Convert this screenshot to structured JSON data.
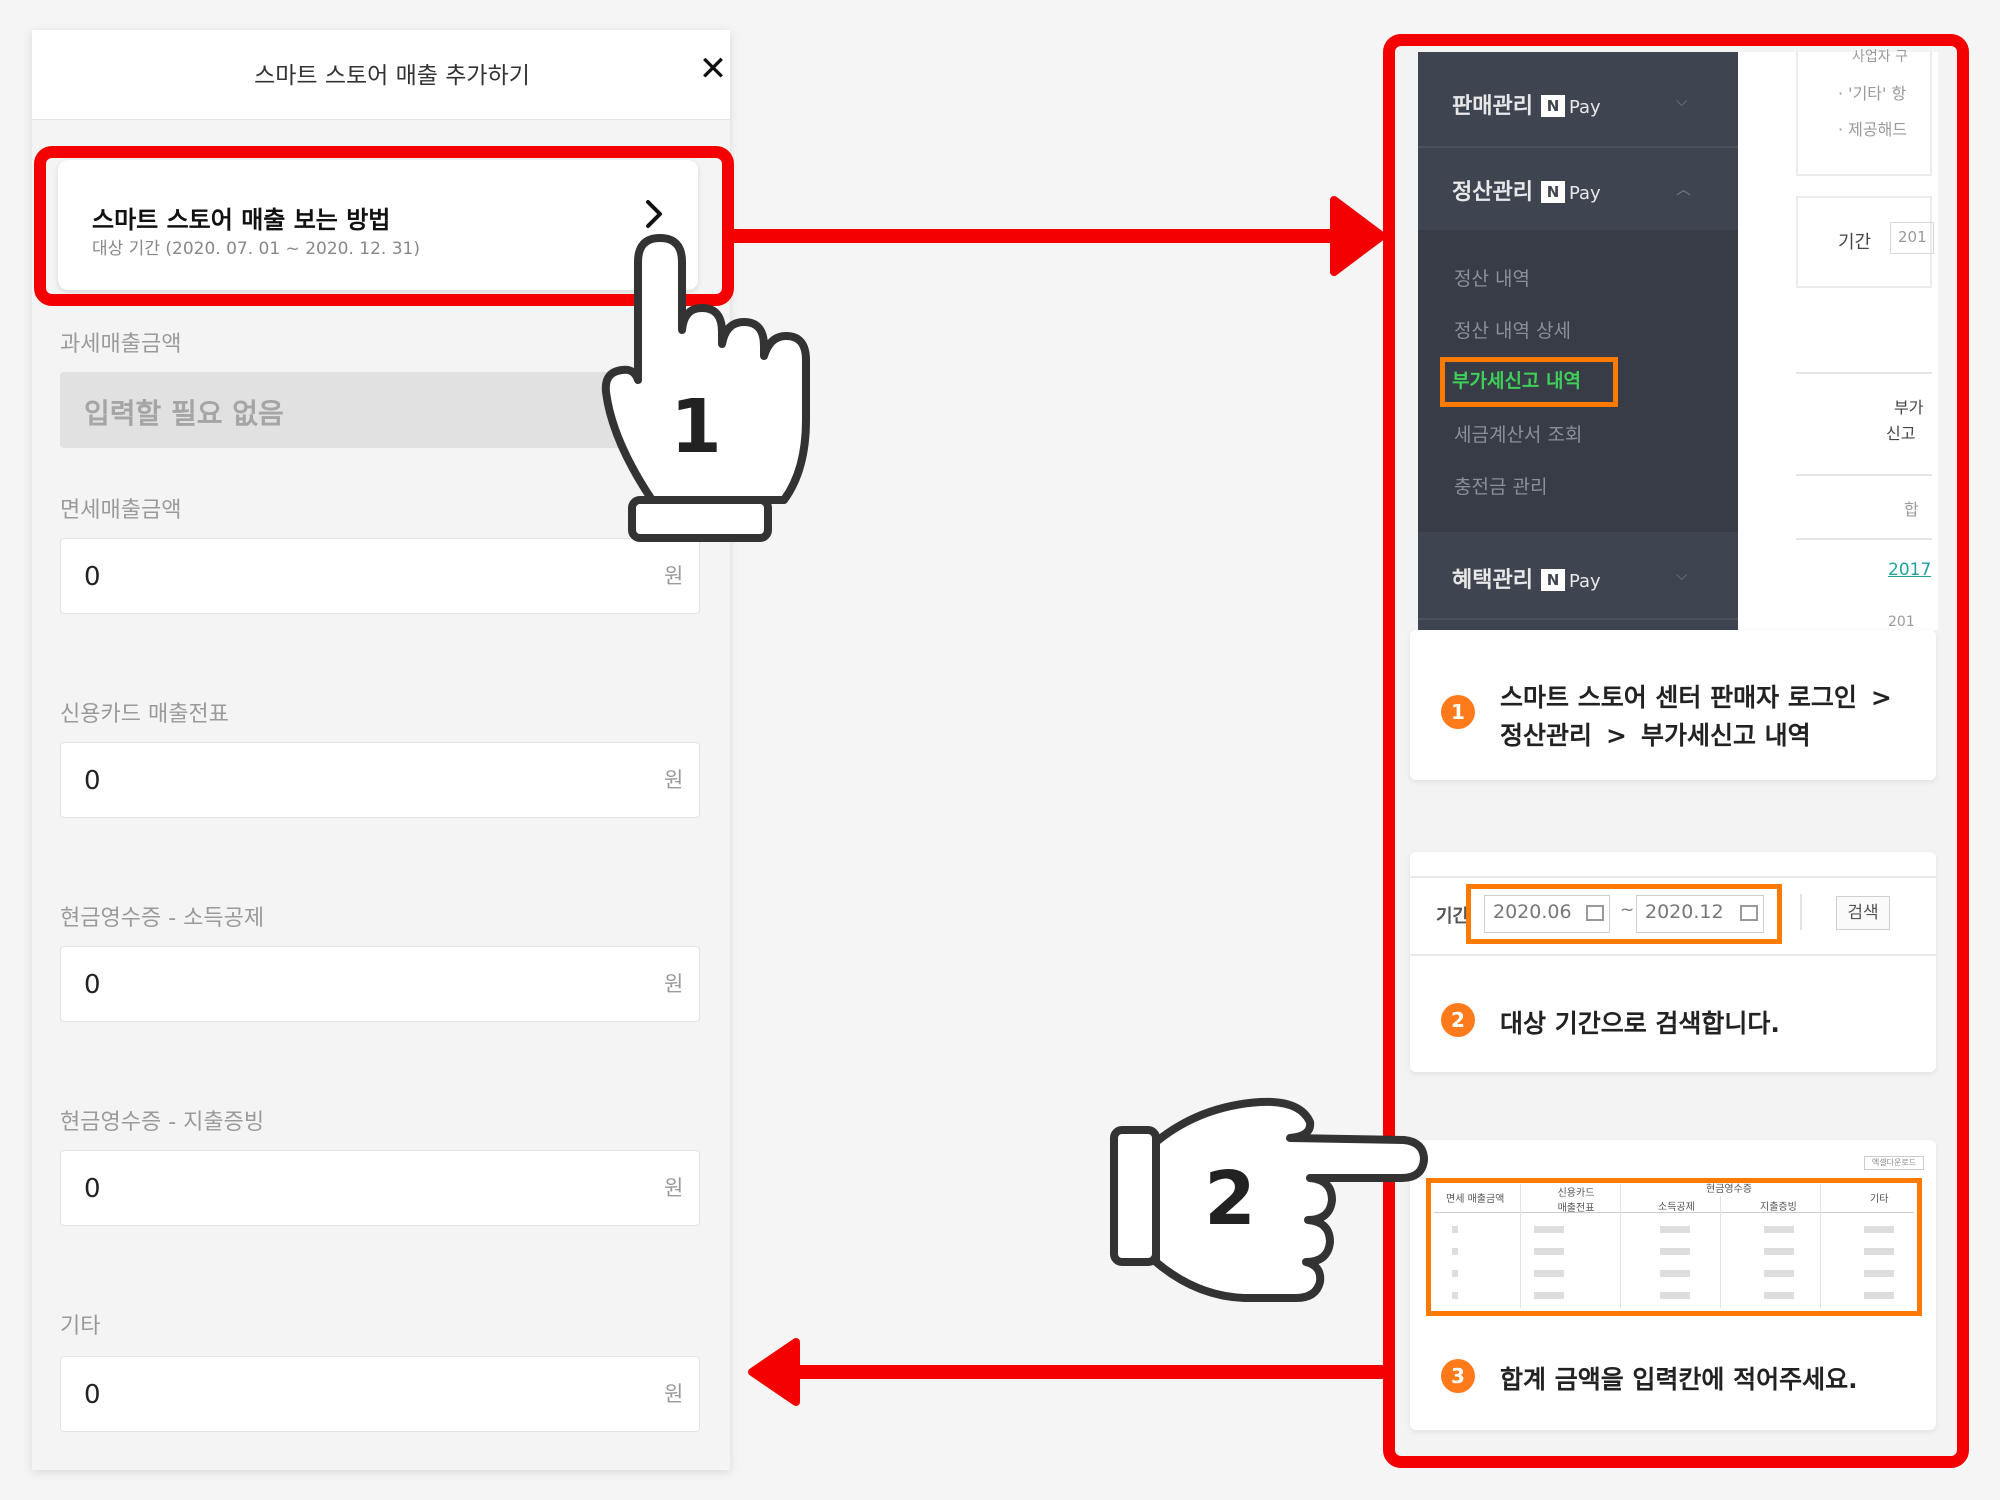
{
  "form": {
    "title": "스마트 스토어 매출 추가하기",
    "howto": {
      "title": "스마트 스토어 매출 보는 방법",
      "period": "대상 기간 (2020. 07. 01 ~ 2020. 12. 31)"
    },
    "taxed_label": "과세매출금액",
    "taxed_placeholder": "입력할 필요 없음",
    "fields": [
      {
        "label": "면세매출금액",
        "value": "0",
        "unit": "원"
      },
      {
        "label": "신용카드 매출전표",
        "value": "0",
        "unit": "원"
      },
      {
        "label": "현금영수증 - 소득공제",
        "value": "0",
        "unit": "원"
      },
      {
        "label": "현금영수증 - 지출증빙",
        "value": "0",
        "unit": "원"
      },
      {
        "label": "기타",
        "value": "0",
        "unit": "원"
      }
    ]
  },
  "hands": {
    "one": "1",
    "two": "2"
  },
  "guide": {
    "nav": {
      "sales": "판매관리",
      "settlement": "정산관리",
      "benefit": "혜택관리",
      "pay_badge": "N",
      "pay_text": "Pay",
      "sub_items": [
        "정산 내역",
        "정산 내역 상세",
        "부가세신고 내역",
        "세금계산서 조회",
        "충전금 관리"
      ]
    },
    "sliver": {
      "top": "사업자 구",
      "etc": "· '기타' 항",
      "provider": "· 제공해드",
      "period": "기간",
      "year": "201",
      "col1": "부가",
      "col2": "신고",
      "sum": "합",
      "link": "2017",
      "tail": "201"
    },
    "step1": {
      "num": "1",
      "line1": "스마트 스토어 센터 판매자 로그인",
      "line2_a": "정산관리",
      "line2_b": "부가세신고 내역",
      "sep": ">"
    },
    "step2": {
      "num": "2",
      "period_label": "기간",
      "start": "2020.06",
      "dash": "~",
      "end": "2020.12",
      "search": "검색",
      "text": "대상 기간으로 검색합니다."
    },
    "step3": {
      "num": "3",
      "text": "합계 금액을 입력칸에 적어주세요.",
      "btn": "엑셀다운로드"
    },
    "table_headers": [
      "면세 매출금액",
      "신용카드 매출전표",
      "소득공제",
      "지출증빙",
      "기타"
    ],
    "table_group": "현금영수증"
  },
  "colors": {
    "red": "#f40000",
    "orange": "#ff7a00",
    "nav_bg": "#3f4550",
    "green": "#3fcf5a"
  }
}
